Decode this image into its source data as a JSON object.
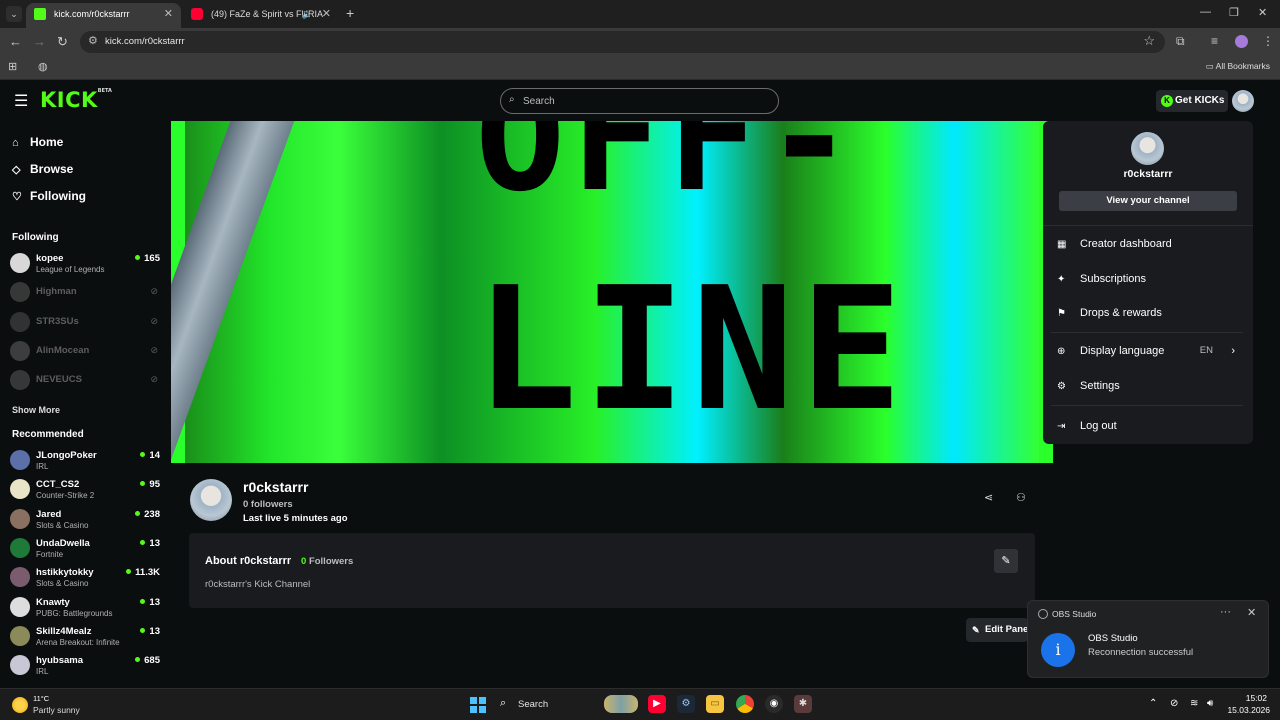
{
  "browser": {
    "tabs": [
      {
        "title": "kick.com/r0ckstarrr",
        "active": true
      },
      {
        "title": "(49) FaZe & Spirit vs FURIA",
        "active": false
      }
    ],
    "url": "kick.com/r0ckstarrr",
    "all_bookmarks": "All Bookmarks"
  },
  "header": {
    "logo": "KICK",
    "logo_badge": "BETA",
    "search_placeholder": "Search",
    "get_kicks": "Get KICKs"
  },
  "sidebar": {
    "nav": [
      {
        "label": "Home",
        "icon": "home-icon"
      },
      {
        "label": "Browse",
        "icon": "compass-icon"
      },
      {
        "label": "Following",
        "icon": "heart-icon"
      }
    ],
    "following_title": "Following",
    "following": [
      {
        "name": "kopee",
        "category": "League of Legends",
        "viewers": "165",
        "live": true,
        "color": "#d8d8d8"
      },
      {
        "name": "Highman",
        "live": false,
        "color": "#888"
      },
      {
        "name": "STR3SUs",
        "live": false,
        "color": "#777"
      },
      {
        "name": "AlinMocean",
        "live": false,
        "color": "#999"
      },
      {
        "name": "NEVEUCS",
        "live": false,
        "color": "#888"
      }
    ],
    "show_more": "Show More",
    "recommended_title": "Recommended",
    "recommended": [
      {
        "name": "JLongoPoker",
        "category": "IRL",
        "viewers": "14",
        "color": "#5b6fa8"
      },
      {
        "name": "CCT_CS2",
        "category": "Counter-Strike 2",
        "viewers": "95",
        "color": "#e9e3c8"
      },
      {
        "name": "Jared",
        "category": "Slots & Casino",
        "viewers": "238",
        "color": "#8a7060"
      },
      {
        "name": "UndaDwella",
        "category": "Fortnite",
        "viewers": "13",
        "color": "#1f7a3a"
      },
      {
        "name": "hstikkytokky",
        "category": "Slots & Casino",
        "viewers": "11.3K",
        "color": "#7a5c6e"
      },
      {
        "name": "Knawty",
        "category": "PUBG: Battlegrounds",
        "viewers": "13",
        "color": "#dddddd"
      },
      {
        "name": "Skillz4Mealz",
        "category": "Arena Breakout: Infinite",
        "viewers": "13",
        "color": "#8a8a5a"
      },
      {
        "name": "hyubsama",
        "category": "IRL",
        "viewers": "685",
        "color": "#c7c7d6"
      }
    ]
  },
  "banner": {
    "line1": "OFF-",
    "line2": "LINE"
  },
  "profile": {
    "name": "r0ckstarrr",
    "followers": "0 followers",
    "last_live": "Last live 5 minutes ago"
  },
  "about": {
    "title": "About r0ckstarrr",
    "followers_count": "0",
    "followers_label": "Followers",
    "description": "r0ckstarrr's Kick Channel"
  },
  "edit_panel": "Edit Panel",
  "menu": {
    "username": "r0ckstarrr",
    "view_channel": "View your channel",
    "items": [
      {
        "label": "Creator dashboard",
        "icon": "dashboard-icon"
      },
      {
        "label": "Subscriptions",
        "icon": "sparkle-icon"
      },
      {
        "label": "Drops & rewards",
        "icon": "drops-icon"
      }
    ],
    "display_language": "Display language",
    "language_value": "EN",
    "settings": "Settings",
    "logout": "Log out"
  },
  "toast": {
    "app": "OBS Studio",
    "title": "OBS Studio",
    "message": "Reconnection successful"
  },
  "taskbar": {
    "temp": "11°C",
    "weather": "Partly sunny",
    "search": "Search",
    "time": "15:02",
    "date": "15.03.2026"
  },
  "colors": {
    "brand": "#53fc18",
    "bg": "#0b0e0f",
    "panel": "#191b1f",
    "toast_icon": "#1a73e8"
  }
}
